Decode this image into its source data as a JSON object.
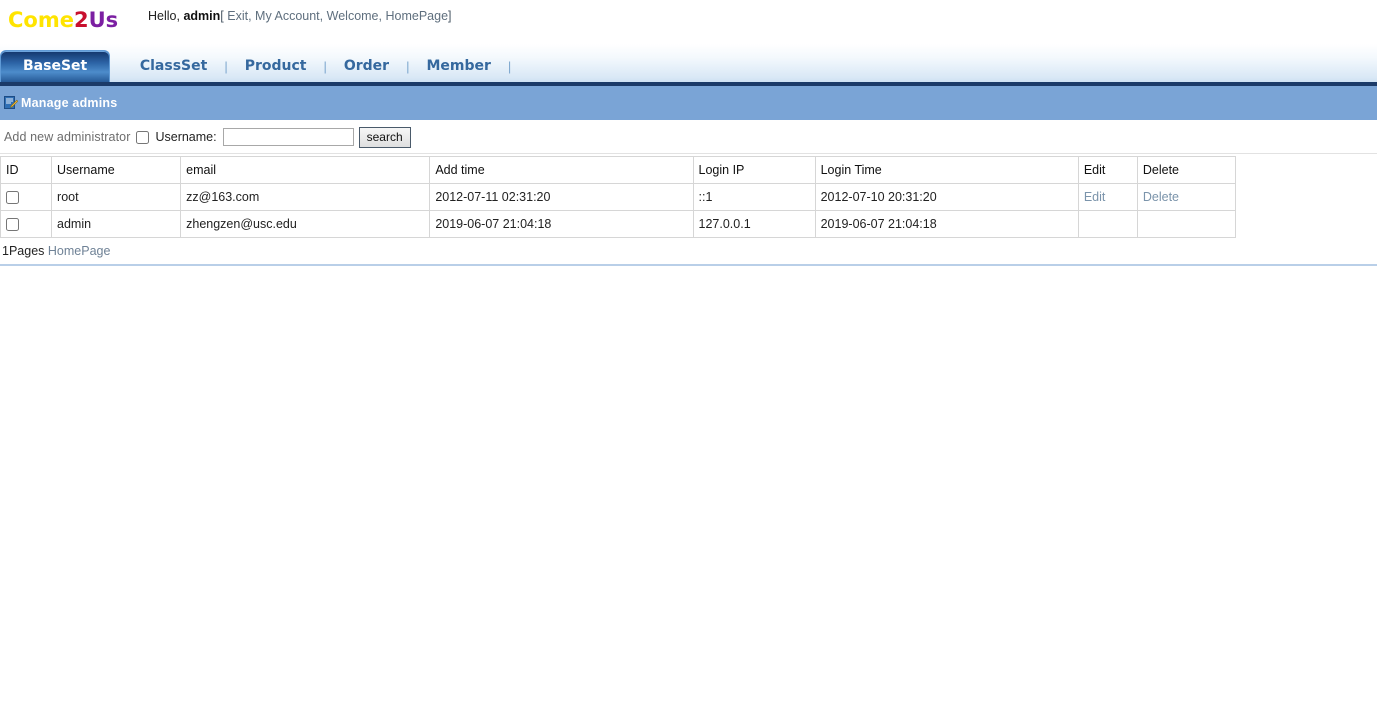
{
  "header": {
    "logo": {
      "part1": "Come",
      "part2": "2",
      "part3": "Us"
    },
    "greeting": "Hello,",
    "username": "admin",
    "bracket_open": "[",
    "bracket_close": "]",
    "comma": ",",
    "links": [
      {
        "label": "Exit"
      },
      {
        "label": "My Account"
      },
      {
        "label": "Welcome"
      },
      {
        "label": "HomePage"
      }
    ]
  },
  "nav": {
    "separator": "|",
    "tabs": [
      {
        "label": "BaseSet",
        "active": true
      },
      {
        "label": "ClassSet",
        "active": false
      },
      {
        "label": "Product",
        "active": false
      },
      {
        "label": "Order",
        "active": false
      },
      {
        "label": "Member",
        "active": false
      }
    ]
  },
  "section": {
    "icon": "document-edit-icon",
    "title": "Manage admins"
  },
  "toolbar": {
    "add_link": "Add new administrator",
    "checkbox_checked": false,
    "username_label": "Username:",
    "username_value": "",
    "username_placeholder": "",
    "search_label": "search"
  },
  "table": {
    "columns": [
      {
        "key": "id",
        "label": "ID"
      },
      {
        "key": "username",
        "label": "Username"
      },
      {
        "key": "email",
        "label": "email"
      },
      {
        "key": "add_time",
        "label": "Add time"
      },
      {
        "key": "login_ip",
        "label": "Login IP"
      },
      {
        "key": "login_time",
        "label": "Login Time"
      },
      {
        "key": "edit",
        "label": "Edit"
      },
      {
        "key": "delete",
        "label": "Delete"
      }
    ],
    "rows": [
      {
        "selected": false,
        "username": "root",
        "email": "zz@163.com",
        "add_time": "2012-07-11 02:31:20",
        "login_ip": "::1",
        "login_time": "2012-07-10 20:31:20",
        "edit": "Edit",
        "delete": "Delete"
      },
      {
        "selected": false,
        "username": "admin",
        "email": "zhengzen@usc.edu",
        "add_time": "2019-06-07 21:04:18",
        "login_ip": "127.0.0.1",
        "login_time": "2019-06-07 21:04:18",
        "edit": "",
        "delete": ""
      }
    ]
  },
  "pager": {
    "pages_text": "1Pages",
    "home_link": "HomePage"
  },
  "colors": {
    "logo_yellow": "#ffe400",
    "logo_red": "#c8102e",
    "logo_purple": "#7b1fa2",
    "nav_active_blue": "#2e66a8",
    "nav_border_navy": "#1b3a68",
    "section_bar_blue": "#7aa4d6",
    "link_gray": "#6d6d6d",
    "row_link": "#7b94ab"
  }
}
